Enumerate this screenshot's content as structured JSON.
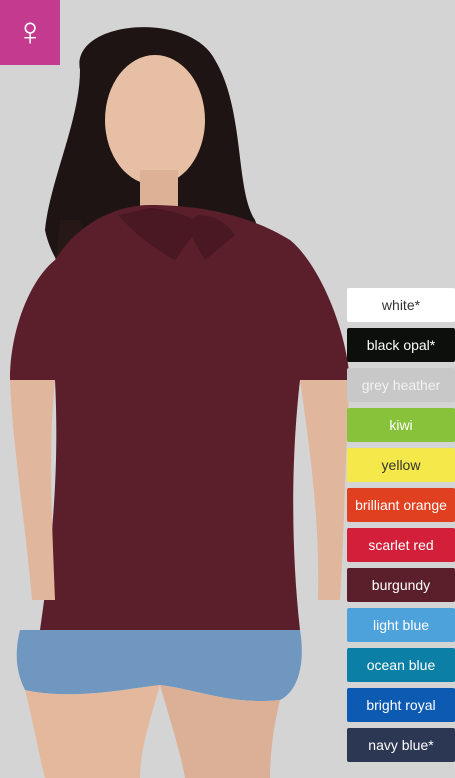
{
  "badge": {
    "icon": "female-symbol-icon",
    "glyph": "♀",
    "color": "#c43a8f"
  },
  "swatches": [
    {
      "label": "white*",
      "bg": "#ffffff",
      "fg": "#333333"
    },
    {
      "label": "black opal*",
      "bg": "#0d0f0c",
      "fg": "#ffffff"
    },
    {
      "label": "grey heather",
      "bg": "#c8c8c8",
      "fg": "#f2f2f2"
    },
    {
      "label": "kiwi",
      "bg": "#87c23a",
      "fg": "#ffffff"
    },
    {
      "label": "yellow",
      "bg": "#f5e84a",
      "fg": "#333333"
    },
    {
      "label": "brilliant orange",
      "bg": "#e0401f",
      "fg": "#ffffff"
    },
    {
      "label": "scarlet red",
      "bg": "#d31f3a",
      "fg": "#ffffff"
    },
    {
      "label": "burgundy",
      "bg": "#5a1f2b",
      "fg": "#ffffff"
    },
    {
      "label": "light blue",
      "bg": "#4ea2dc",
      "fg": "#ffffff"
    },
    {
      "label": "ocean blue",
      "bg": "#0c7fa6",
      "fg": "#ffffff"
    },
    {
      "label": "bright royal",
      "bg": "#0d5ab2",
      "fg": "#ffffff"
    },
    {
      "label": "navy blue*",
      "bg": "#2b3753",
      "fg": "#ffffff"
    }
  ]
}
